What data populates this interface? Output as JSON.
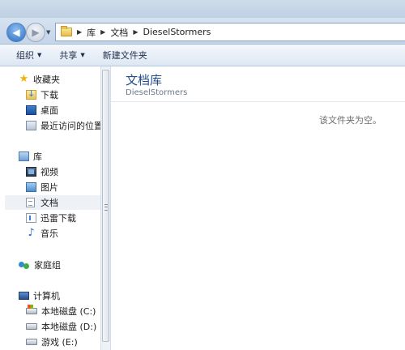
{
  "address": {
    "crumbs": [
      "库",
      "文档",
      "DieselStormers"
    ]
  },
  "toolbar": {
    "organize": "组织",
    "share": "共享",
    "new_folder": "新建文件夹"
  },
  "nav": {
    "favorites": "收藏夹",
    "downloads": "下载",
    "desktop": "桌面",
    "recent": "最近访问的位置",
    "libraries": "库",
    "videos": "视频",
    "pictures": "图片",
    "documents": "文档",
    "xunlei": "迅雷下载",
    "music": "音乐",
    "homegroup": "家庭组",
    "computer": "计算机",
    "drive_c": "本地磁盘 (C:)",
    "drive_d": "本地磁盘 (D:)",
    "drive_e": "游戏 (E:)"
  },
  "content": {
    "library_title": "文档库",
    "library_subtitle": "DieselStormers",
    "empty_message": "该文件夹为空。"
  }
}
